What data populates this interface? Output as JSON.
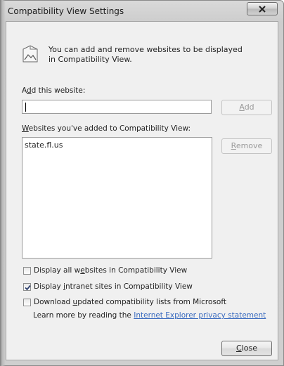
{
  "window": {
    "title": "Compatibility View Settings",
    "close_icon": "close-icon"
  },
  "info": {
    "icon": "compatibility-view-icon",
    "text": "You can add and remove websites to be displayed in Compatibility View."
  },
  "add_website": {
    "label_pre": "A",
    "label_acc": "d",
    "label_post": "d this website:",
    "value": "",
    "button_pre": "",
    "button_acc": "A",
    "button_post": "dd"
  },
  "website_list": {
    "label_pre": "",
    "label_acc": "W",
    "label_post": "ebsites you've added to Compatibility View:",
    "items": [
      "state.fl.us"
    ],
    "remove_pre": "",
    "remove_acc": "R",
    "remove_post": "emove"
  },
  "options": [
    {
      "pre": "Display all w",
      "acc": "e",
      "post": "bsites in Compatibility View",
      "checked": false
    },
    {
      "pre": "Display ",
      "acc": "i",
      "post": "ntranet sites in Compatibility View",
      "checked": true
    },
    {
      "pre": "Download ",
      "acc": "u",
      "post": "pdated compatibility lists from Microsoft",
      "checked": false
    }
  ],
  "learn_more": {
    "prefix": "Learn more by reading the ",
    "link": "Internet Explorer privacy statement"
  },
  "close_button": {
    "pre": "",
    "acc": "C",
    "post": "lose"
  }
}
